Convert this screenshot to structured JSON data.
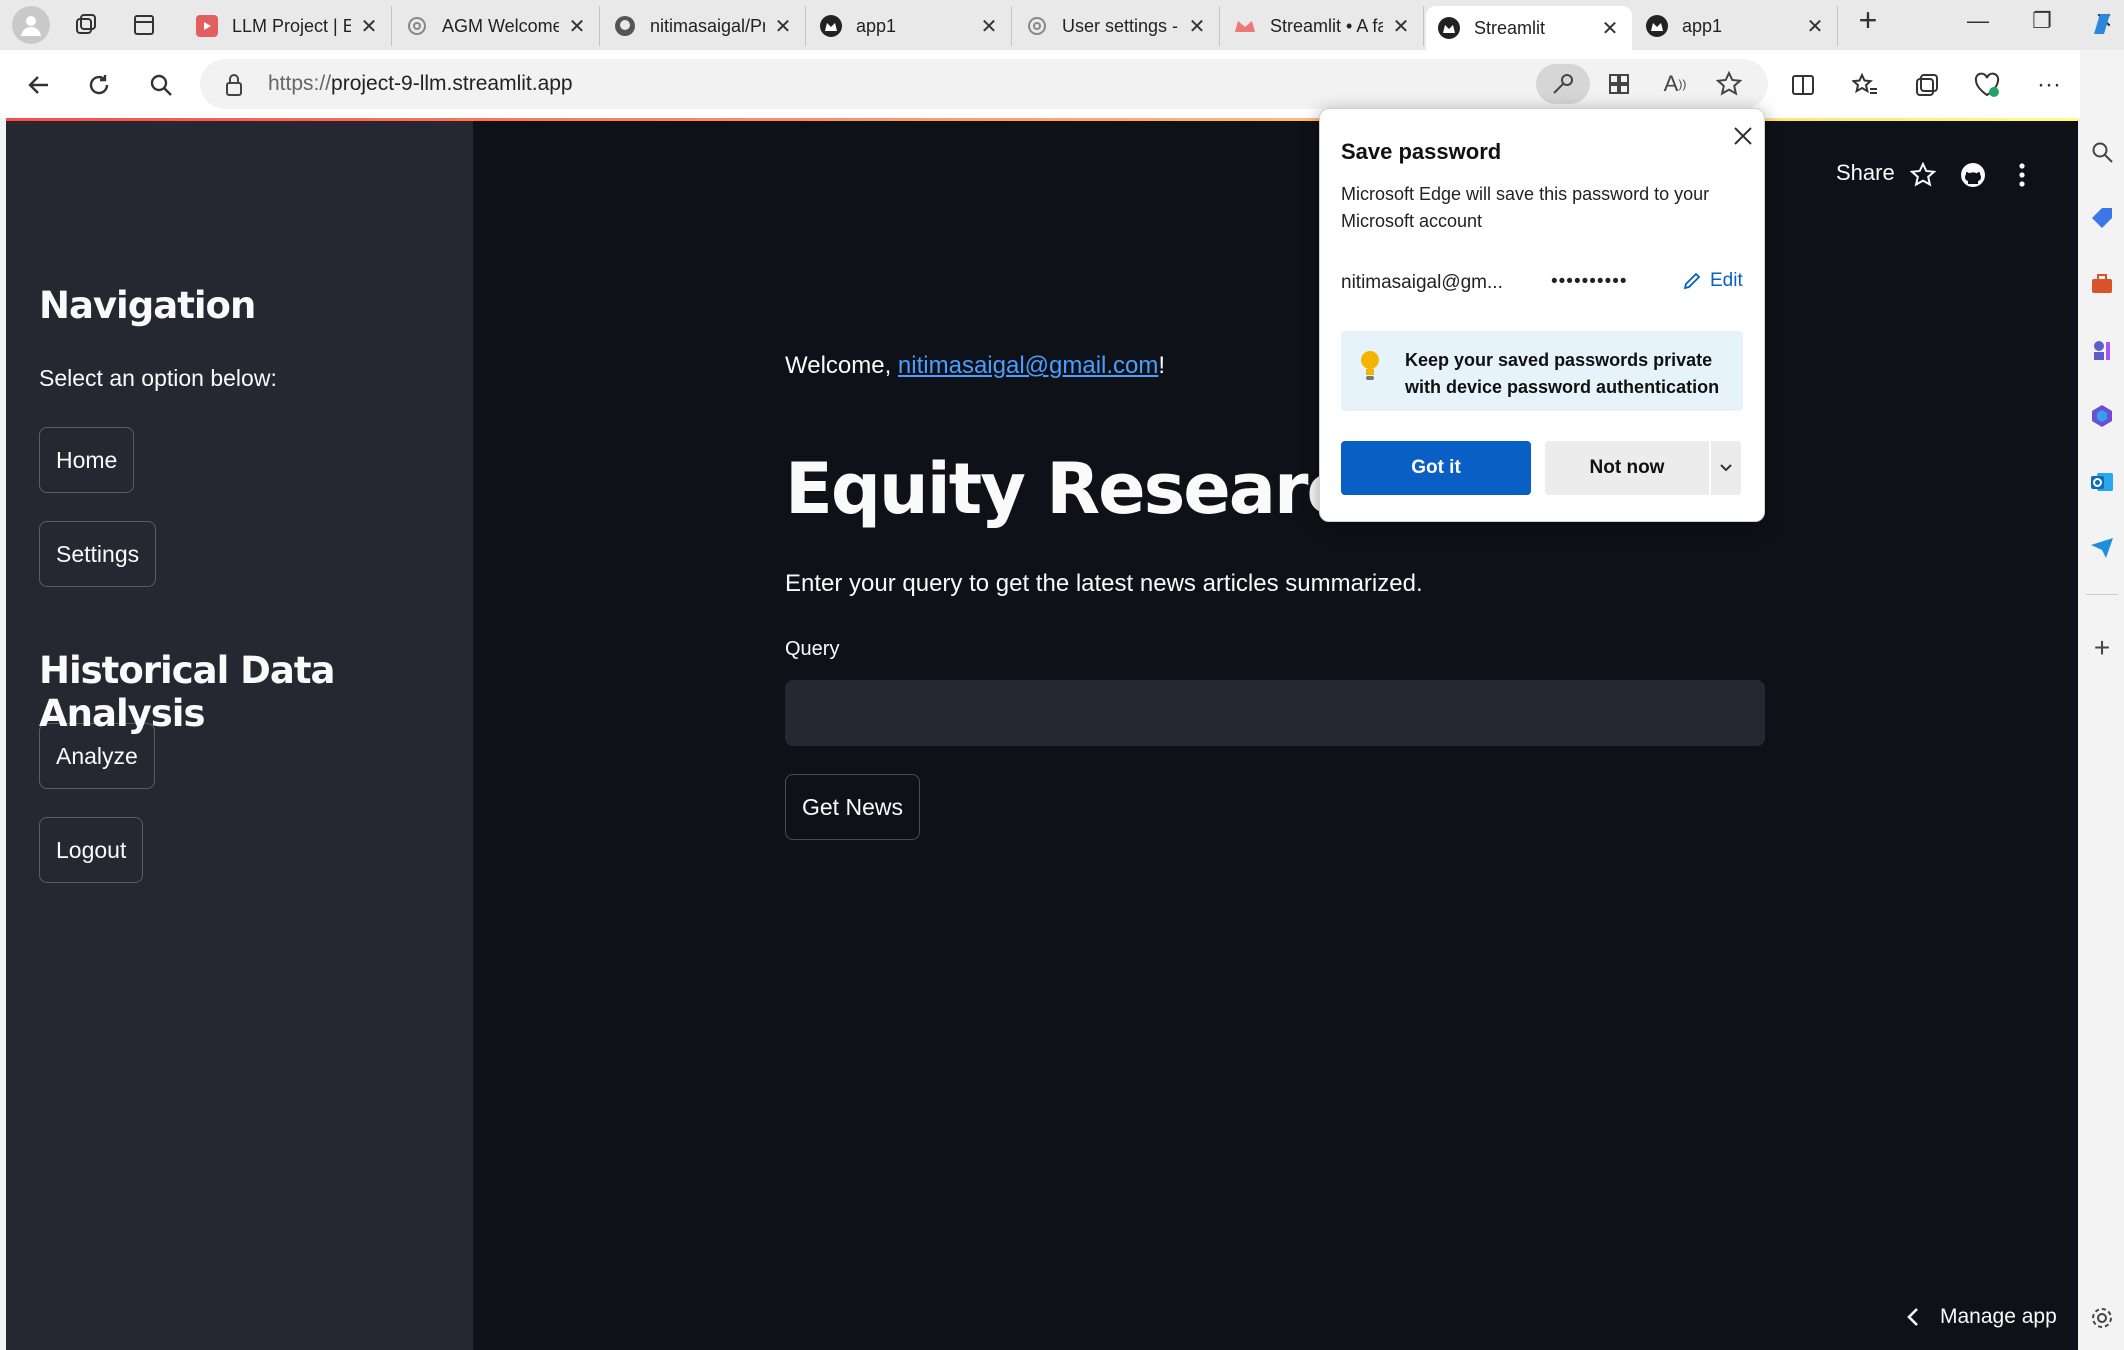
{
  "browser": {
    "tabs": [
      {
        "title": "LLM Project | En",
        "icon": "youtube-icon",
        "active": false
      },
      {
        "title": "AGM Welcome",
        "icon": "openai-icon",
        "active": false
      },
      {
        "title": "nitimasaigal/Pro",
        "icon": "github-icon",
        "active": false
      },
      {
        "title": "app1",
        "icon": "streamlit-icon",
        "active": false
      },
      {
        "title": "User settings - C",
        "icon": "openai-icon",
        "active": false
      },
      {
        "title": "Streamlit • A fas",
        "icon": "streamlit-crown-icon",
        "active": false
      },
      {
        "title": "Streamlit",
        "icon": "streamlit-icon",
        "active": true
      },
      {
        "title": "app1",
        "icon": "streamlit-icon",
        "active": false
      }
    ],
    "address": {
      "scheme": "https://",
      "host": "project-9-llm.streamlit.app"
    },
    "colors": {
      "tabbar": "#e9e9e9",
      "accent": "#0a5fc4"
    }
  },
  "sidebar": {
    "heading": "Navigation",
    "subtext": "Select an option below:",
    "buttons": {
      "home": "Home",
      "settings": "Settings"
    },
    "heading2": "Historical Data Analysis",
    "buttons2": {
      "analyze": "Analyze",
      "logout": "Logout"
    }
  },
  "header": {
    "share": "Share"
  },
  "main": {
    "welcome_prefix": "Welcome, ",
    "welcome_email": "nitimasaigal@gmail.com",
    "welcome_suffix": "!",
    "title": "Equity Research New",
    "description": "Enter your query to get the latest news articles summarized.",
    "query_label": "Query",
    "query_value": "",
    "button": "Get News"
  },
  "footer": {
    "manage": "Manage app"
  },
  "popup": {
    "title": "Save password",
    "description": "Microsoft Edge will save this password to your Microsoft account",
    "username": "nitimasaigal@gm...",
    "password_mask": "••••••••••",
    "edit": "Edit",
    "tip": "Keep your saved passwords private with device password authentication",
    "got_it": "Got it",
    "not_now": "Not now"
  }
}
